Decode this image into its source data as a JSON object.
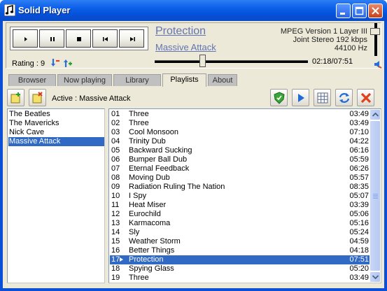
{
  "window": {
    "title": "Solid Player"
  },
  "player": {
    "controls": [
      {
        "name": "play-button",
        "icon": "play-icon"
      },
      {
        "name": "pause-button",
        "icon": "pause-icon"
      },
      {
        "name": "stop-button",
        "icon": "stop-icon"
      },
      {
        "name": "previous-button",
        "icon": "previous-icon"
      },
      {
        "name": "next-button",
        "icon": "next-icon"
      }
    ],
    "rating_label": "Rating : 9",
    "song_title": "Protection",
    "song_artist": "Massive Attack",
    "codec_line1": "MPEG Version 1 Layer III",
    "codec_line2": "Joint Stereo  192 kbps",
    "codec_line3": "44100 Hz",
    "time": "02:18/07:51",
    "seek_fraction": 0.29
  },
  "tabs": [
    "Browser",
    "Now playing",
    "Library",
    "Playlists",
    "About"
  ],
  "active_tab": "Playlists",
  "toolbar": {
    "active_label": "Active : Massive Attack"
  },
  "artists": [
    "The Beatles",
    "The Mavericks",
    "Nick Cave",
    "Massive Attack"
  ],
  "selected_artist": "Massive Attack",
  "tracks": [
    {
      "num": "01",
      "name": "Three",
      "dur": "03:49"
    },
    {
      "num": "02",
      "name": "Three",
      "dur": "03:49"
    },
    {
      "num": "03",
      "name": "Cool Monsoon",
      "dur": "07:10"
    },
    {
      "num": "04",
      "name": "Trinity Dub",
      "dur": "04:22"
    },
    {
      "num": "05",
      "name": "Backward Sucking",
      "dur": "06:16"
    },
    {
      "num": "06",
      "name": "Bumper Ball Dub",
      "dur": "05:59"
    },
    {
      "num": "07",
      "name": "Eternal Feedback",
      "dur": "06:26"
    },
    {
      "num": "08",
      "name": "Moving Dub",
      "dur": "05:57"
    },
    {
      "num": "09",
      "name": "Radiation Ruling The Nation",
      "dur": "08:35"
    },
    {
      "num": "10",
      "name": "I Spy",
      "dur": "05:07"
    },
    {
      "num": "11",
      "name": "Heat Miser",
      "dur": "03:39"
    },
    {
      "num": "12",
      "name": "Eurochild",
      "dur": "05:06"
    },
    {
      "num": "13",
      "name": "Karmacoma",
      "dur": "05:16"
    },
    {
      "num": "14",
      "name": "Sly",
      "dur": "05:24"
    },
    {
      "num": "15",
      "name": "Weather Storm",
      "dur": "04:59"
    },
    {
      "num": "16",
      "name": "Better Things",
      "dur": "04:18"
    },
    {
      "num": "17",
      "name": "Protection",
      "dur": "07:51"
    },
    {
      "num": "18",
      "name": "Spying Glass",
      "dur": "05:20"
    },
    {
      "num": "19",
      "name": "Three",
      "dur": "03:49"
    }
  ],
  "selected_track": "17",
  "colors": {
    "selection": "#316ac5",
    "link": "#6274b2",
    "titlebar": "#0b5fe8"
  }
}
